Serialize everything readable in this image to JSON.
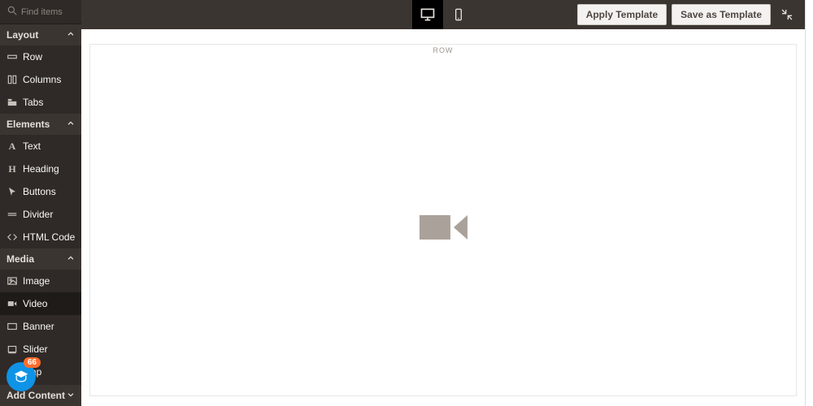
{
  "search": {
    "placeholder": "Find items"
  },
  "groups": {
    "layout": {
      "title": "Layout",
      "items": [
        {
          "icon": "row",
          "label": "Row"
        },
        {
          "icon": "columns",
          "label": "Columns"
        },
        {
          "icon": "tabs",
          "label": "Tabs"
        }
      ]
    },
    "elements": {
      "title": "Elements",
      "items": [
        {
          "icon": "text",
          "label": "Text"
        },
        {
          "icon": "heading",
          "label": "Heading"
        },
        {
          "icon": "buttons",
          "label": "Buttons"
        },
        {
          "icon": "divider",
          "label": "Divider"
        },
        {
          "icon": "code",
          "label": "HTML Code"
        }
      ]
    },
    "media": {
      "title": "Media",
      "items": [
        {
          "icon": "image",
          "label": "Image"
        },
        {
          "icon": "video",
          "label": "Video",
          "selected": true
        },
        {
          "icon": "banner",
          "label": "Banner"
        },
        {
          "icon": "slider",
          "label": "Slider"
        },
        {
          "icon": "map",
          "label": "Map"
        }
      ]
    },
    "add_content": {
      "title": "Add Content"
    }
  },
  "topbar": {
    "apply": "Apply Template",
    "save": "Save as Template"
  },
  "canvas": {
    "row_label": "ROW"
  },
  "help": {
    "badge": "66"
  }
}
